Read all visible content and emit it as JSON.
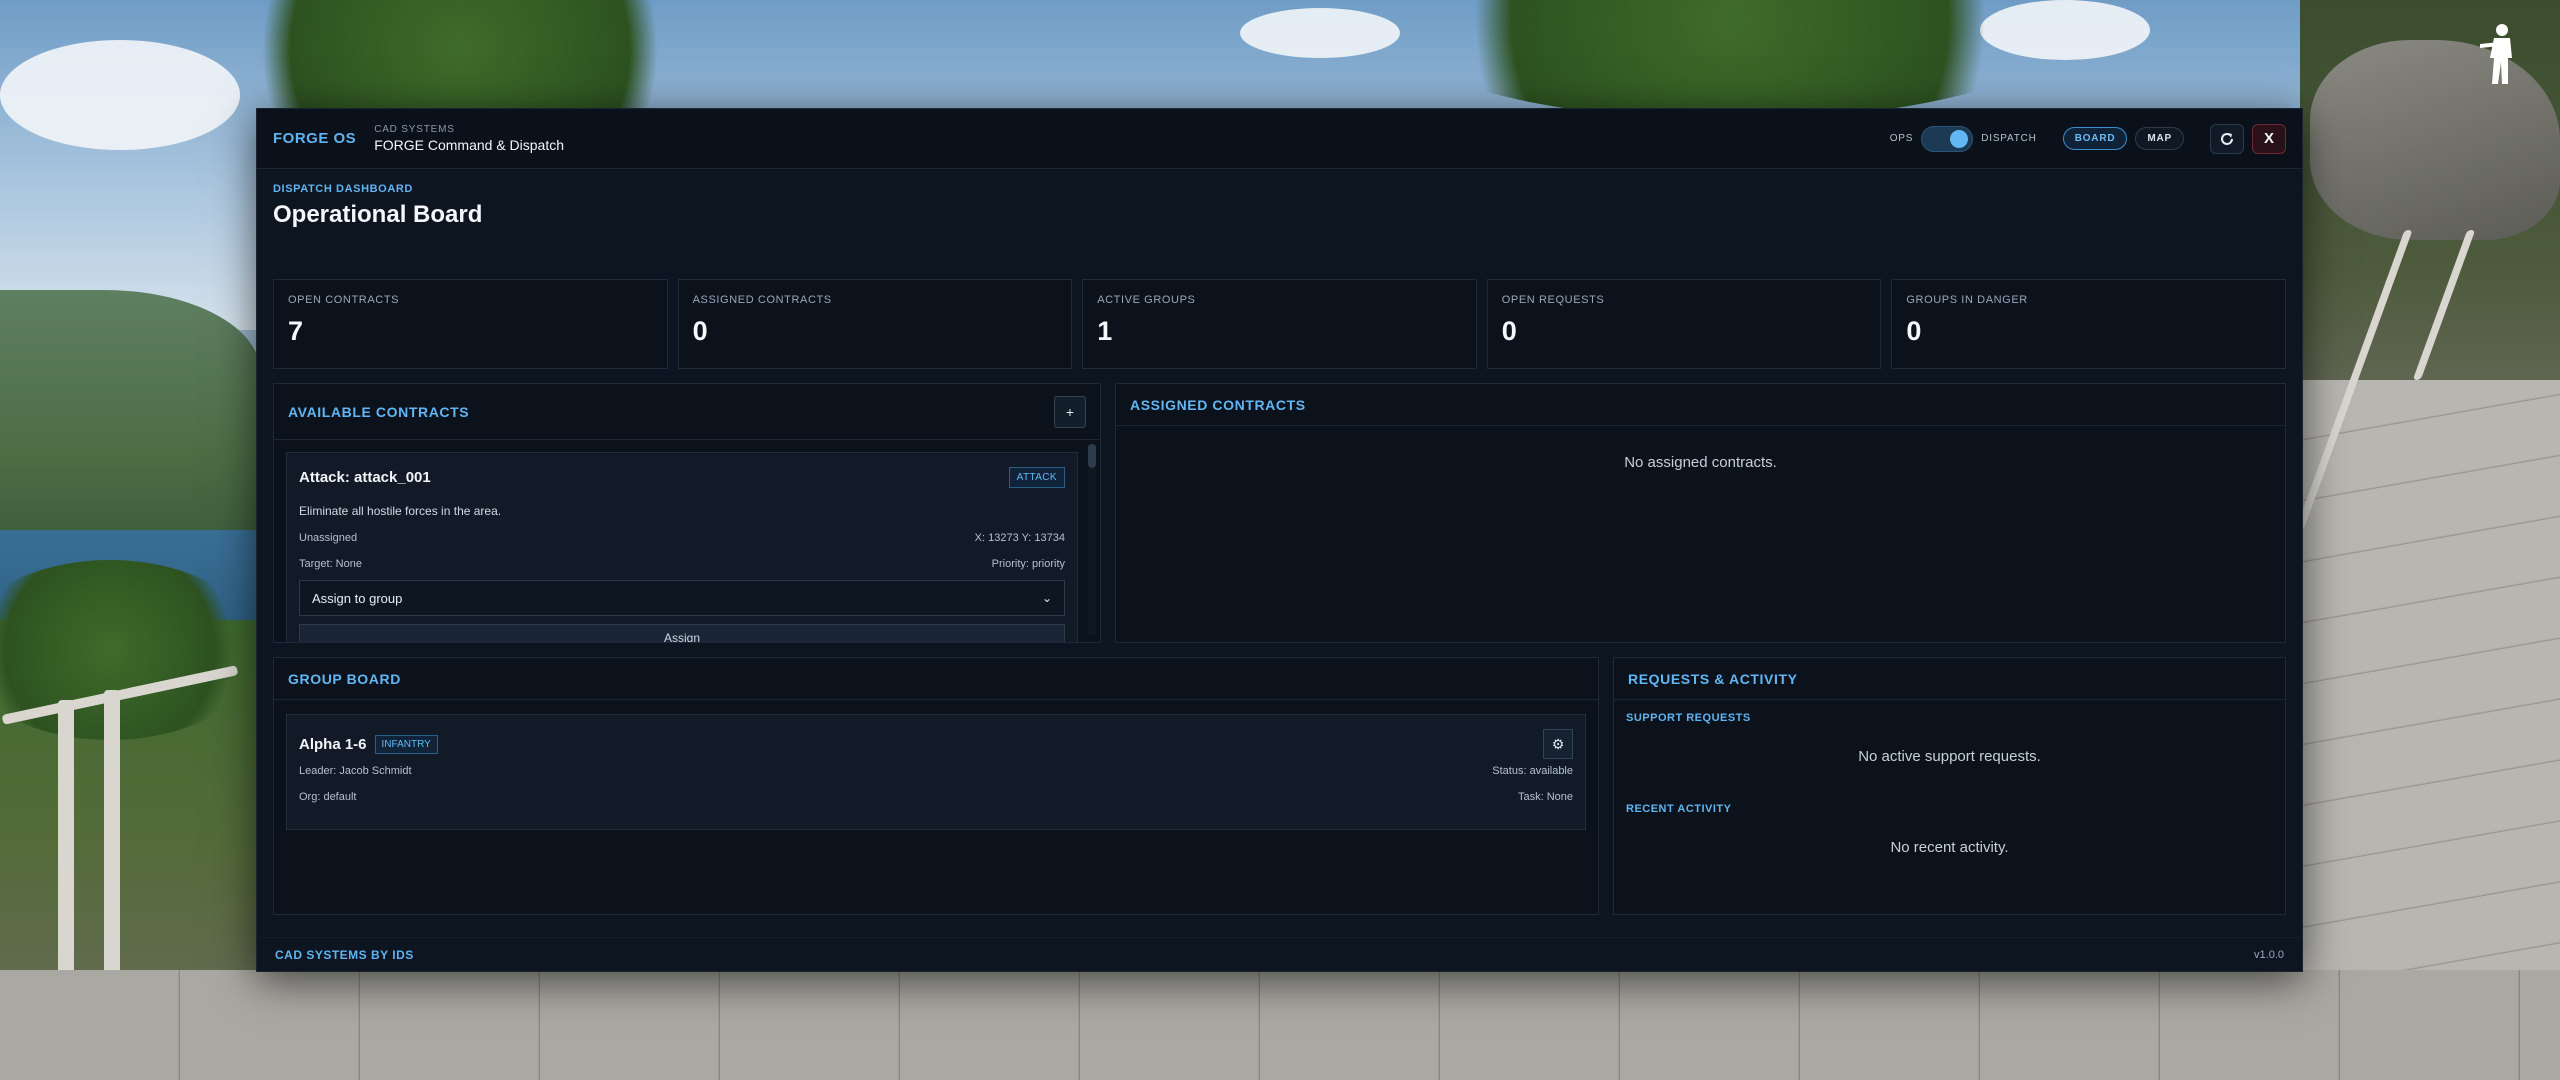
{
  "titlebar": {
    "brand": "FORGE OS",
    "subtitle": "CAD SYSTEMS",
    "title": "FORGE Command & Dispatch",
    "mode_left": "OPS",
    "mode_right": "DISPATCH",
    "mode_state": "DISPATCH",
    "tabs": [
      {
        "label": "BOARD",
        "active": true
      },
      {
        "label": "MAP",
        "active": false
      }
    ],
    "refresh_icon": "refresh-icon",
    "close_label": "X"
  },
  "header": {
    "eyebrow": "DISPATCH DASHBOARD",
    "title": "Operational Board"
  },
  "stats": [
    {
      "label": "OPEN CONTRACTS",
      "value": "7"
    },
    {
      "label": "ASSIGNED CONTRACTS",
      "value": "0"
    },
    {
      "label": "ACTIVE GROUPS",
      "value": "1"
    },
    {
      "label": "OPEN REQUESTS",
      "value": "0"
    },
    {
      "label": "GROUPS IN DANGER",
      "value": "0"
    }
  ],
  "available": {
    "title": "AVAILABLE CONTRACTS",
    "add_label": "+",
    "contract": {
      "title": "Attack: attack_001",
      "tag": "ATTACK",
      "description": "Eliminate all hostile forces in the area.",
      "assignment": "Unassigned",
      "coords": "X: 13273 Y: 13734",
      "target": "Target: None",
      "priority": "Priority: priority",
      "select_value": "Assign to group",
      "assign_label": "Assign"
    }
  },
  "assigned": {
    "title": "ASSIGNED CONTRACTS",
    "empty": "No assigned contracts."
  },
  "groups": {
    "title": "GROUP BOARD",
    "items": [
      {
        "name": "Alpha 1-6",
        "tag": "INFANTRY",
        "leader": "Leader: Jacob Schmidt",
        "status": "Status: available",
        "org": "Org: default",
        "task": "Task: None"
      }
    ]
  },
  "requests": {
    "title": "REQUESTS & ACTIVITY",
    "support_label": "SUPPORT REQUESTS",
    "support_empty": "No active support requests.",
    "activity_label": "RECENT ACTIVITY",
    "activity_empty": "No recent activity."
  },
  "footer": {
    "brand": "CAD SYSTEMS BY IDS",
    "version": "v1.0.0"
  },
  "colors": {
    "accent": "#5fb4f2",
    "window_bg": "#0d1520",
    "panel_bg": "#0b121c",
    "close_border": "#6a2b34"
  }
}
